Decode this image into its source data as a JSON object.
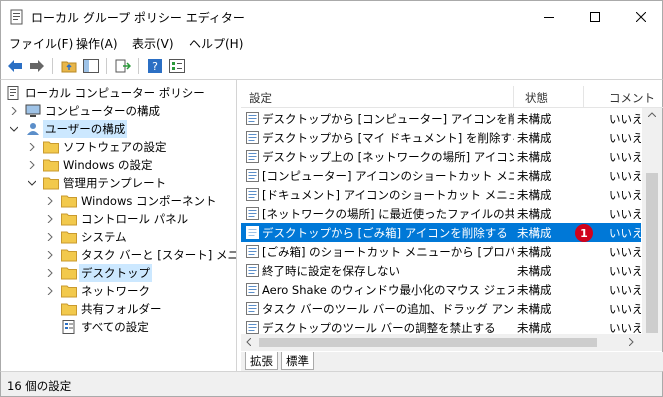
{
  "window": {
    "title": "ローカル グループ ポリシー エディター"
  },
  "menu": [
    "ファイル(F)",
    "操作(A)",
    "表示(V)",
    "ヘルプ(H)"
  ],
  "tree": [
    {
      "label": "ローカル コンピューター ポリシー",
      "level": 0
    },
    {
      "label": "コンピューターの構成",
      "level": 1
    },
    {
      "label": "ユーザーの構成",
      "level": 1
    },
    {
      "label": "ソフトウェアの設定",
      "level": 2
    },
    {
      "label": "Windows の設定",
      "level": 2
    },
    {
      "label": "管理用テンプレート",
      "level": 2
    },
    {
      "label": "Windows コンポーネント",
      "level": 3
    },
    {
      "label": "コントロール パネル",
      "level": 3
    },
    {
      "label": "システム",
      "level": 3
    },
    {
      "label": "タスク バーと [スタート] メニュー",
      "level": 3
    },
    {
      "label": "デスクトップ",
      "level": 3
    },
    {
      "label": "ネットワーク",
      "level": 3
    },
    {
      "label": "共有フォルダー",
      "level": 3
    },
    {
      "label": "すべての設定",
      "level": 3
    }
  ],
  "list": {
    "headers": {
      "name": "設定",
      "state": "状態",
      "comment": "コメント"
    },
    "rows": [
      {
        "name": "デスクトップから [コンピューター] アイコンを削除する",
        "state": "未構成",
        "comment": "いいえ"
      },
      {
        "name": "デスクトップから [マイ ドキュメント] を削除する",
        "state": "未構成",
        "comment": "いいえ"
      },
      {
        "name": "デスクトップ上の [ネットワークの場所] アイコンを...",
        "state": "未構成",
        "comment": "いいえ"
      },
      {
        "name": "[コンピューター] アイコンのショートカット メニューから...",
        "state": "未構成",
        "comment": "いいえ"
      },
      {
        "name": "[ドキュメント] アイコンのショートカット メニューから [...",
        "state": "未構成",
        "comment": "いいえ"
      },
      {
        "name": "[ネットワークの場所] に最近使ったファイルの共有...",
        "state": "未構成",
        "comment": "いいえ"
      },
      {
        "name": "デスクトップから [ごみ箱] アイコンを削除する",
        "state": "未構成",
        "comment": "いいえ"
      },
      {
        "name": "[ごみ箱] のショートカット メニューから [プロパティ] ...",
        "state": "未構成",
        "comment": "いいえ"
      },
      {
        "name": "終了時に設定を保存しない",
        "state": "未構成",
        "comment": "いいえ"
      },
      {
        "name": "Aero Shake のウィンドウ最小化のマウス ジェスチ...",
        "state": "未構成",
        "comment": "いいえ"
      },
      {
        "name": "タスク バーのツール バーの追加、ドラッグ アンド ド...",
        "state": "未構成",
        "comment": "いいえ"
      },
      {
        "name": "デスクトップのツール バーの調整を禁止する",
        "state": "未構成",
        "comment": "いいえ"
      }
    ],
    "selected_index": 6,
    "badge": "1"
  },
  "tabs": [
    "拡張",
    "標準"
  ],
  "status": "16 個の設定",
  "colors": {
    "selection": "#0078d7",
    "tree_selection": "#cce8ff",
    "badge": "#d0021b"
  }
}
